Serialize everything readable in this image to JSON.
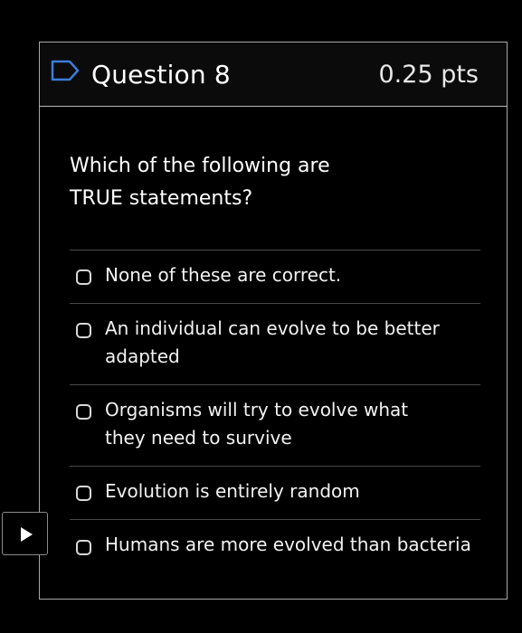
{
  "question": {
    "title": "Question 8",
    "points": "0.25 pts",
    "text": "Which of the following are TRUE statements?"
  },
  "answers": [
    {
      "label": "None of these are correct.",
      "checked": false
    },
    {
      "label": "An individual can evolve to be better adapted",
      "checked": false
    },
    {
      "label": "Organisms will try to evolve what they need to survive",
      "checked": false
    },
    {
      "label": "Evolution is entirely random",
      "checked": false
    },
    {
      "label": "Humans are more evolved than bacteria",
      "checked": false
    }
  ],
  "icons": {
    "flag": "flag-outline-icon",
    "play": "play-icon"
  },
  "colors": {
    "background": "#000000",
    "border": "#a8a8a8",
    "flag": "#3b7dd8"
  }
}
